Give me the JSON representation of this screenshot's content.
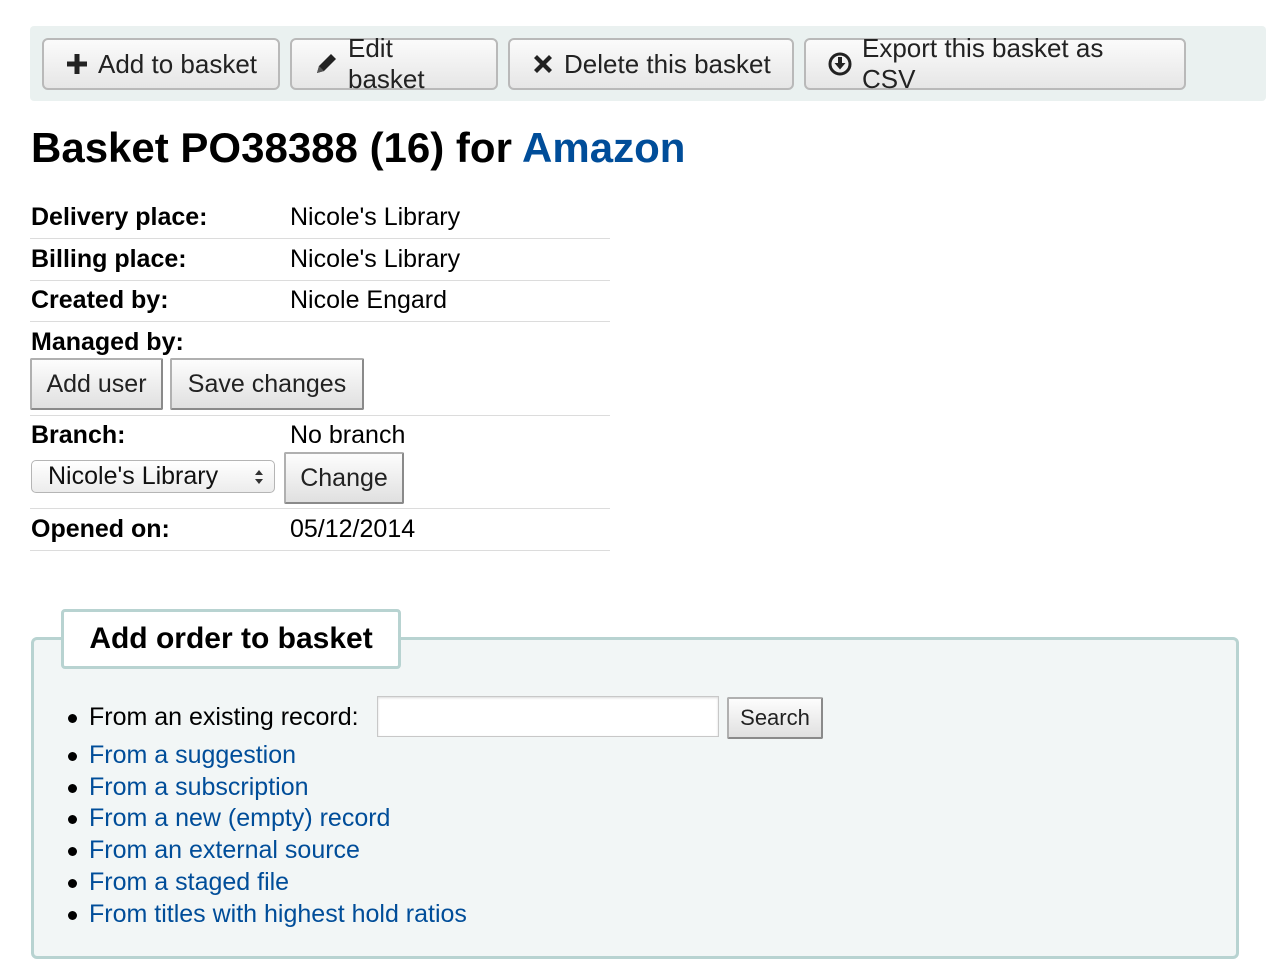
{
  "toolbar": {
    "add_to_basket": "Add to basket",
    "edit_basket": "Edit basket",
    "delete_basket": "Delete this basket",
    "export_csv": "Export this basket as CSV"
  },
  "title": {
    "prefix": "Basket PO38388 (16) for ",
    "vendor": "Amazon"
  },
  "details": {
    "delivery_label": "Delivery place:",
    "delivery_value": "Nicole's Library",
    "billing_label": "Billing place:",
    "billing_value": "Nicole's Library",
    "created_label": "Created by:",
    "created_value": "Nicole Engard",
    "managed_label": "Managed by:",
    "add_user": "Add user",
    "save_changes": "Save changes",
    "branch_label": "Branch:",
    "branch_value": "No branch",
    "branch_select": "Nicole's Library",
    "change": "Change",
    "opened_label": "Opened on:",
    "opened_value": "05/12/2014"
  },
  "add_order": {
    "legend": "Add order to basket",
    "existing_record": "From an existing record:",
    "search_placeholder": "",
    "search_button": "Search",
    "links": [
      "From a suggestion",
      "From a subscription",
      "From a new (empty) record",
      "From an external source",
      "From a staged file",
      "From titles with highest hold ratios"
    ]
  },
  "colors": {
    "link": "#004d99",
    "toolbar_bg": "#eaf1f0",
    "fieldset_border": "#b8d3d1",
    "fieldset_bg": "#f2f6f6"
  }
}
